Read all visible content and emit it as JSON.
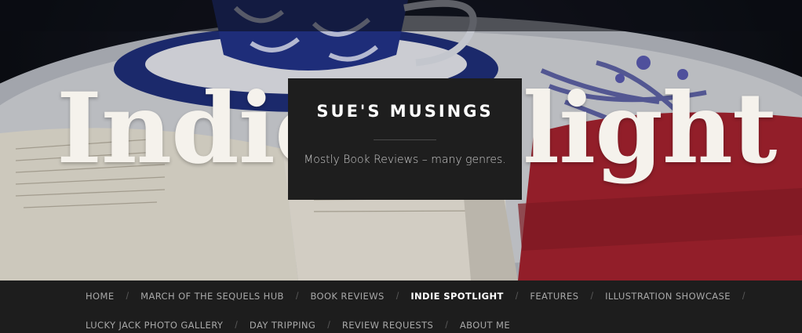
{
  "hero": {
    "overlay_text": "Indie Spotlight",
    "overlay_text_visible_start": "Indie",
    "overlay_text_visible_end": "light"
  },
  "site": {
    "title": "SUE'S MUSINGS",
    "description": "Mostly Book Reviews – many genres."
  },
  "nav": {
    "items": [
      {
        "label": "HOME",
        "current": false
      },
      {
        "label": "MARCH OF THE SEQUELS HUB",
        "current": false
      },
      {
        "label": "BOOK REVIEWS",
        "current": false
      },
      {
        "label": "INDIE SPOTLIGHT",
        "current": true
      },
      {
        "label": "FEATURES",
        "current": false
      },
      {
        "label": "ILLUSTRATION SHOWCASE",
        "current": false
      },
      {
        "label": "LUCKY JACK PHOTO GALLERY",
        "current": false
      },
      {
        "label": "DAY TRIPPING",
        "current": false
      },
      {
        "label": "REVIEW REQUESTS",
        "current": false
      },
      {
        "label": "ABOUT ME",
        "current": false
      }
    ],
    "separator": "/"
  },
  "colors": {
    "nav_background": "#1d1d1d",
    "nav_text": "#a8a8a8",
    "nav_current": "#ffffff",
    "title_box": "#1e1e1e"
  }
}
